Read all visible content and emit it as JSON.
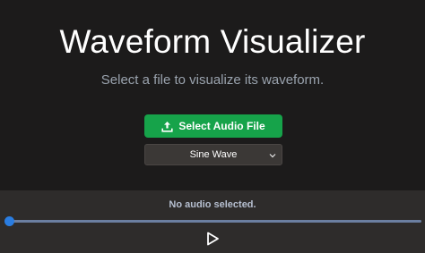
{
  "app": {
    "title": "Waveform Visualizer",
    "subtitle": "Select a file to visualize its waveform."
  },
  "controls": {
    "upload_label": "Select Audio File",
    "upload_icon": "upload-icon",
    "waveform_select": {
      "selected": "Sine Wave",
      "icon": "chevron-down-icon"
    }
  },
  "player": {
    "status": "No audio selected.",
    "progress": 0,
    "play_icon": "play-icon"
  },
  "colors": {
    "background": "#1c1b1b",
    "player_bar": "#2e2c2b",
    "accent_green": "#16a34a",
    "slider_thumb": "#2a7de1",
    "slider_track": "#6b7fa1"
  }
}
